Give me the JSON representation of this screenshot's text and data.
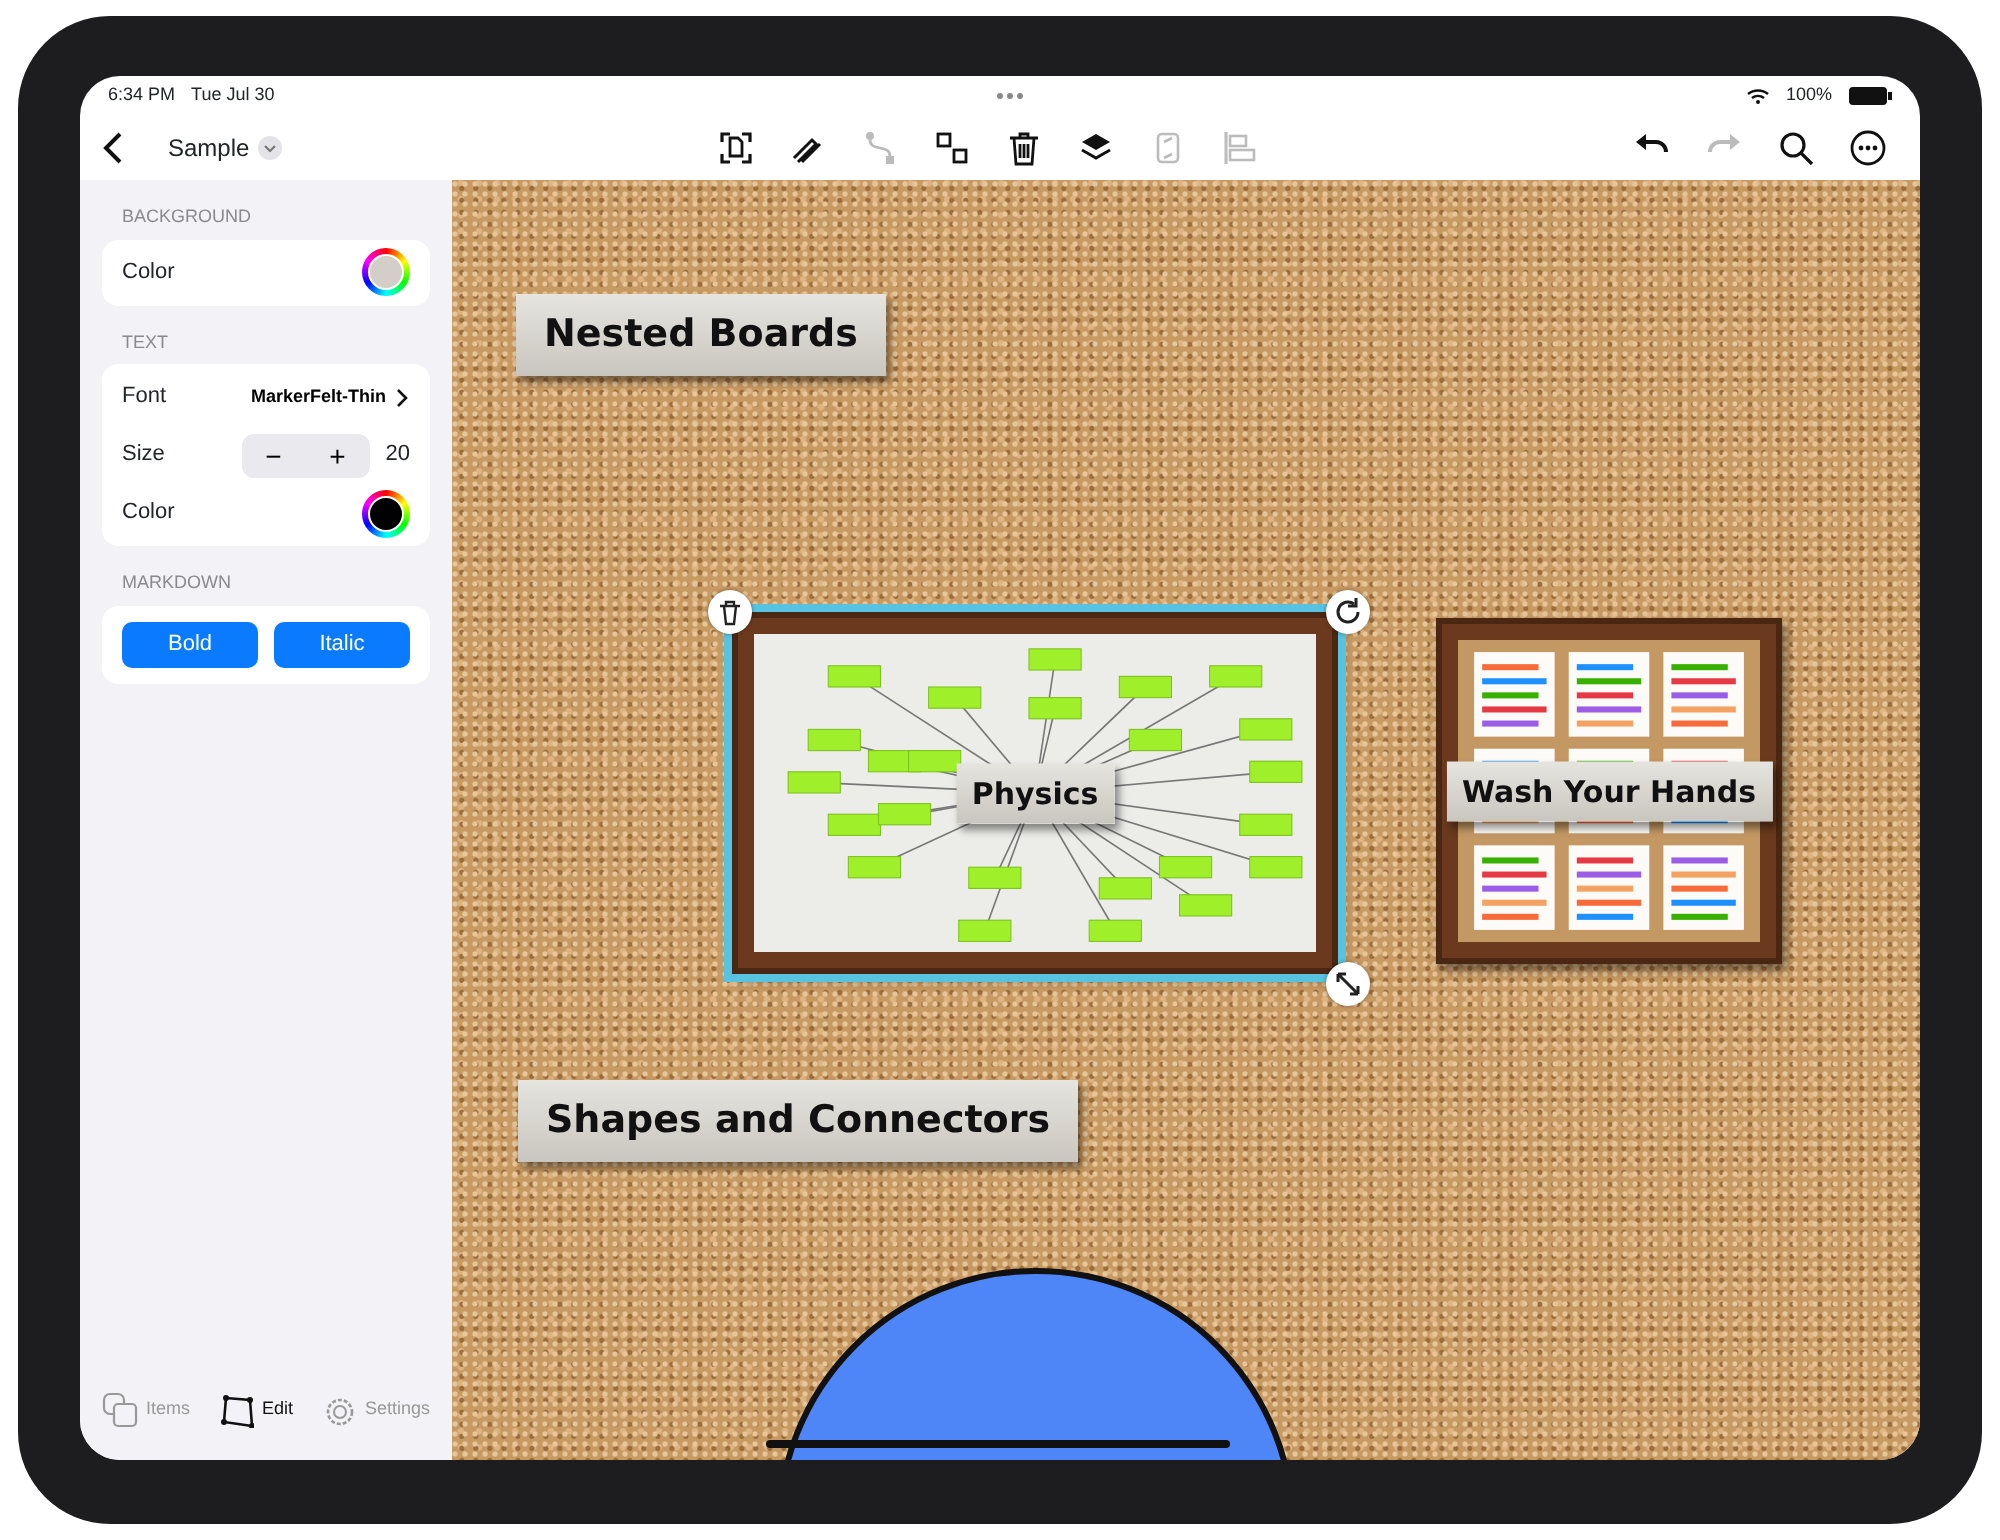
{
  "status_bar": {
    "time": "6:34 PM",
    "date": "Tue Jul 30",
    "battery": "100%"
  },
  "nav": {
    "title": "Sample"
  },
  "toolbar": [
    {
      "kind": "scan",
      "disabled": false
    },
    {
      "kind": "pen",
      "disabled": false
    },
    {
      "kind": "connector",
      "disabled": true
    },
    {
      "kind": "group",
      "disabled": false
    },
    {
      "kind": "trash",
      "disabled": false
    },
    {
      "kind": "layers",
      "disabled": false
    },
    {
      "kind": "flip",
      "disabled": true
    },
    {
      "kind": "align",
      "disabled": true
    }
  ],
  "toolbar_right": [
    {
      "kind": "undo",
      "disabled": false
    },
    {
      "kind": "redo",
      "disabled": true
    },
    {
      "kind": "search",
      "disabled": false
    },
    {
      "kind": "more",
      "disabled": false
    }
  ],
  "sidebar": {
    "sections": [
      {
        "title": "BACKGROUND",
        "rows": [
          {
            "kind": "color",
            "label": "Color",
            "color": "#d3cfc8"
          }
        ]
      },
      {
        "title": "TEXT",
        "rows": [
          {
            "kind": "link",
            "label": "Font",
            "value": "MarkerFelt-Thin"
          },
          {
            "kind": "stepper",
            "label": "Size",
            "value": "20",
            "decrement": "−",
            "increment": "+"
          },
          {
            "kind": "color",
            "label": "Color",
            "color": "#000000"
          }
        ]
      },
      {
        "title": "MARKDOWN",
        "buttons": [
          "Bold",
          "Italic"
        ]
      }
    ],
    "tabs": [
      {
        "label": "Items",
        "selected": false
      },
      {
        "label": "Edit",
        "selected": true
      },
      {
        "label": "Settings",
        "selected": false
      }
    ]
  },
  "canvas": {
    "items": [
      {
        "kind": "label",
        "text": "Nested Boards"
      },
      {
        "kind": "board",
        "title": "Physics",
        "thumbnail": {
          "kind": "mindmap"
        },
        "selected": true
      },
      {
        "kind": "board",
        "title": "Wash Your Hands",
        "thumbnail": {
          "kind": "notes"
        },
        "selected": false
      },
      {
        "kind": "label",
        "text": "Shapes and Connectors"
      },
      {
        "kind": "shape",
        "color": "#4f86f7"
      }
    ]
  }
}
